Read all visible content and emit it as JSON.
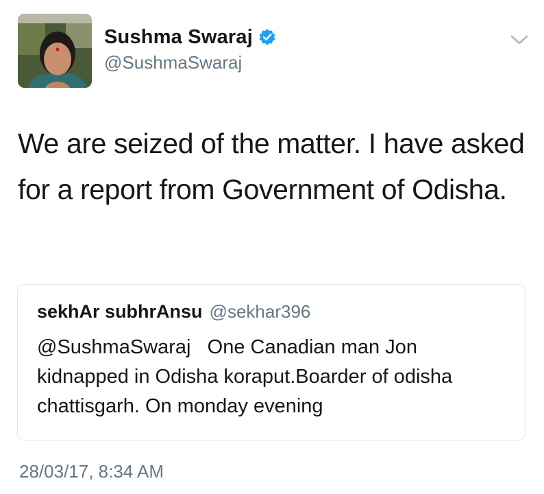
{
  "author": {
    "display_name": "Sushma Swaraj",
    "handle": "@SushmaSwaraj",
    "verified": true
  },
  "tweet": {
    "text": "We are seized of the matter. I have asked for a report from Government of Odisha."
  },
  "quoted_tweet": {
    "display_name": "sekhAr subhrAnsu",
    "handle": "@sekhar396",
    "text": "@SushmaSwaraj   One Canadian man Jon kidnapped in Odisha koraput.Boarder of odisha chattisgarh. On monday evening"
  },
  "timestamp": "28/03/17, 8:34 AM",
  "icons": {
    "verified": "verified-badge-icon",
    "menu": "chevron-down-icon"
  },
  "colors": {
    "verified_blue": "#1da1f2",
    "secondary_text": "#657786",
    "border": "#e1e8ed"
  }
}
